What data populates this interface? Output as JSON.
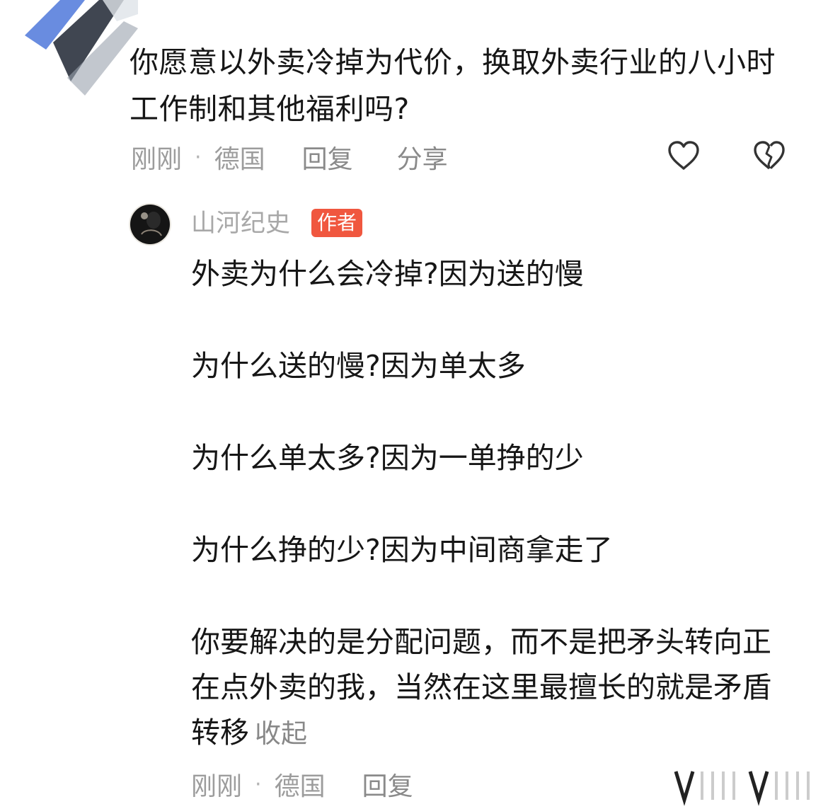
{
  "comment": {
    "text": "你愿意以外卖冷掉为代价，换取外卖行业的八小时工作制和其他福利吗?",
    "time": "刚刚",
    "location": "德国",
    "reply_label": "回复",
    "share_label": "分享"
  },
  "reply": {
    "username": "山河纪史",
    "badge": "作者",
    "paragraphs": [
      "外卖为什么会冷掉?因为送的慢",
      "为什么送的慢?因为单太多",
      "为什么单太多?因为一单挣的少",
      "为什么挣的少?因为中间商拿走了",
      "你要解决的是分配问题，而不是把矛头转向正在点外卖的我，当然在这里最擅长的就是矛盾转移"
    ],
    "collapse_label": "收起",
    "time": "刚刚",
    "location": "德国",
    "reply_label": "回复"
  },
  "icons": {
    "like": "heart-outline-icon",
    "dislike": "broken-heart-icon"
  },
  "colors": {
    "badge": "#f0573f",
    "meta_text": "#9c9c9c"
  }
}
